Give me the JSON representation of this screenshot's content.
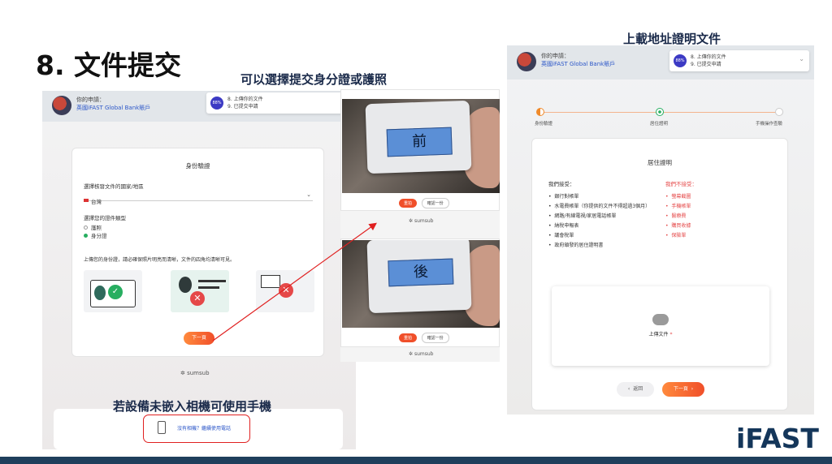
{
  "slide": {
    "title": "8. 文件提交",
    "caption_center_pre": "可以選擇提交",
    "caption_center_b1": "身分證",
    "caption_center_mid": "或",
    "caption_center_b2": "護照",
    "caption_right": "上載地址證明文件",
    "caption_bottom": "若設備未嵌入相機可使用手機",
    "logo": "iFAST"
  },
  "header": {
    "app_label": "你的申請：",
    "app_value": "英國iFAST Global Bank賬戶",
    "progress_pct": "88%",
    "step_current": "8. 上傳你的文件",
    "step_next": "9. 已提交申請"
  },
  "identity": {
    "card_title": "身份驗證",
    "country_label": "選擇核發文件的國家/地區",
    "country_value": "台灣",
    "doc_type_label": "選擇您的證件類型",
    "options": [
      "護照",
      "身分證"
    ],
    "instruction": "上傳您的身份證，請必確保照片明亮而清晰，文件的四角均清晰可見。",
    "next_button": "下一頁",
    "no_camera_link": "沒有相機？繼續使用電話"
  },
  "capture": {
    "front_label": "前",
    "back_label": "後",
    "btn_primary": "重拍",
    "btn_secondary": "確認一份",
    "powered": "sumsub"
  },
  "address": {
    "steps": [
      "身份驗證",
      "居住證明",
      "手機操作查驗"
    ],
    "card_title": "居住證明",
    "accept_title": "我們接受：",
    "reject_title": "我們不接受：",
    "accept": [
      "銀行對帳單",
      "水電費帳單（你提供的文件不得超過3個月）",
      "網路/有線電視/家居電話帳單",
      "納稅申報表",
      "議會稅單",
      "政府頒發的居住證明書"
    ],
    "reject": [
      "螢幕截圖",
      "手機帳單",
      "醫療費",
      "購買收據",
      "保險單"
    ],
    "upload_label": "上傳文件",
    "back_button": "返回",
    "next_button": "下一頁"
  },
  "colors": {
    "accent": "#f04f2a",
    "brand": "#14365a",
    "link": "#2b56c8",
    "annotation": "#e02020"
  }
}
